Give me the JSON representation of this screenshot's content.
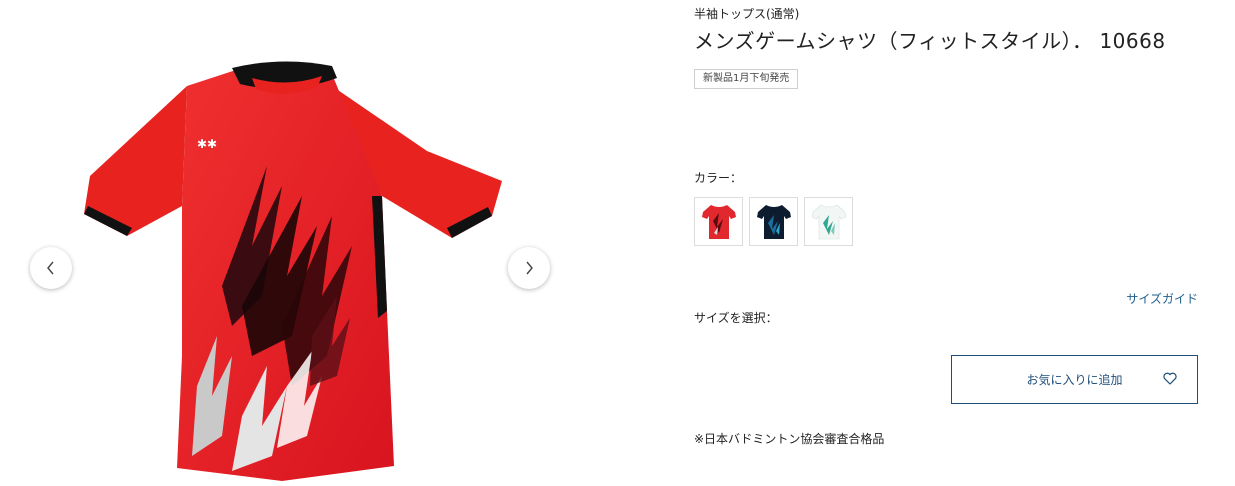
{
  "product": {
    "category": "半袖トップス(通常)",
    "title": "メンズゲームシャツ（フィットスタイル）． 10668",
    "badge": "新製品1月下旬発売",
    "color_label": "カラー：",
    "colors": [
      {
        "name": "red",
        "hex": "#e0282e"
      },
      {
        "name": "navy",
        "hex": "#0d1c2e"
      },
      {
        "name": "white-green",
        "hex": "#f2f7f5"
      }
    ],
    "size_label": "サイズを選択：",
    "size_guide": "サイズガイド",
    "favorite_button": "お気に入りに追加",
    "note": "※日本バドミントン協会審査合格品"
  },
  "gallery": {
    "prev_icon": "chevron-left-icon",
    "next_icon": "chevron-right-icon",
    "shirt_color": "#e41f2a",
    "accent": "#1f4e79"
  }
}
